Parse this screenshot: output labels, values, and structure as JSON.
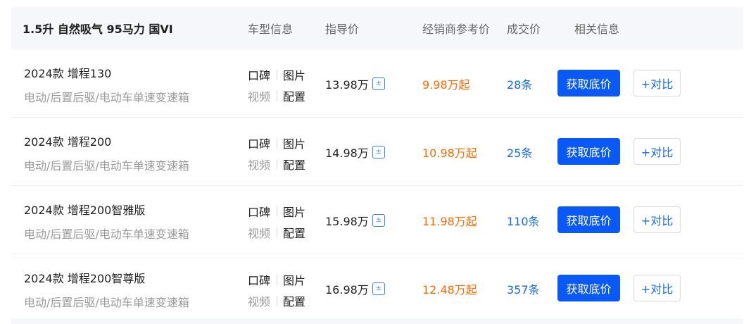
{
  "header": {
    "title": "1.5升 自然吸气 95马力 国VI",
    "columns": [
      "车型信息",
      "指导价",
      "经销商参考价",
      "成交价",
      "相关信息"
    ]
  },
  "rows": [
    {
      "name": "2024款 增程130",
      "spec": "电动/后置后驱/电动车单速变速箱",
      "links": [
        "口碑",
        "图片",
        "视频",
        "配置"
      ],
      "guide_price": "13.98万",
      "dealer_price": "9.98万起",
      "deals": "28条",
      "get_price": "获取底价",
      "compare": "+对比"
    },
    {
      "name": "2024款 增程200",
      "spec": "电动/后置后驱/电动车单速变速箱",
      "links": [
        "口碑",
        "图片",
        "视频",
        "配置"
      ],
      "guide_price": "14.98万",
      "dealer_price": "10.98万起",
      "deals": "25条",
      "get_price": "获取底价",
      "compare": "+对比"
    },
    {
      "name": "2024款 增程200智雅版",
      "spec": "电动/后置后驱/电动车单速变速箱",
      "links": [
        "口碑",
        "图片",
        "视频",
        "配置"
      ],
      "guide_price": "15.98万",
      "dealer_price": "11.98万起",
      "deals": "110条",
      "get_price": "获取底价",
      "compare": "+对比"
    },
    {
      "name": "2024款 增程200智尊版",
      "spec": "电动/后置后驱/电动车单速变速箱",
      "links": [
        "口碑",
        "图片",
        "视频",
        "配置"
      ],
      "guide_price": "16.98万",
      "dealer_price": "12.48万起",
      "deals": "357条",
      "get_price": "获取底价",
      "compare": "+对比"
    }
  ],
  "icons": {
    "calculator": "calculator-icon"
  },
  "colors": {
    "primary_button": "#0a59f5",
    "dealer_price": "#ff6a00",
    "deal_count": "#1469e6",
    "header_bg": "#f5f7fa"
  }
}
